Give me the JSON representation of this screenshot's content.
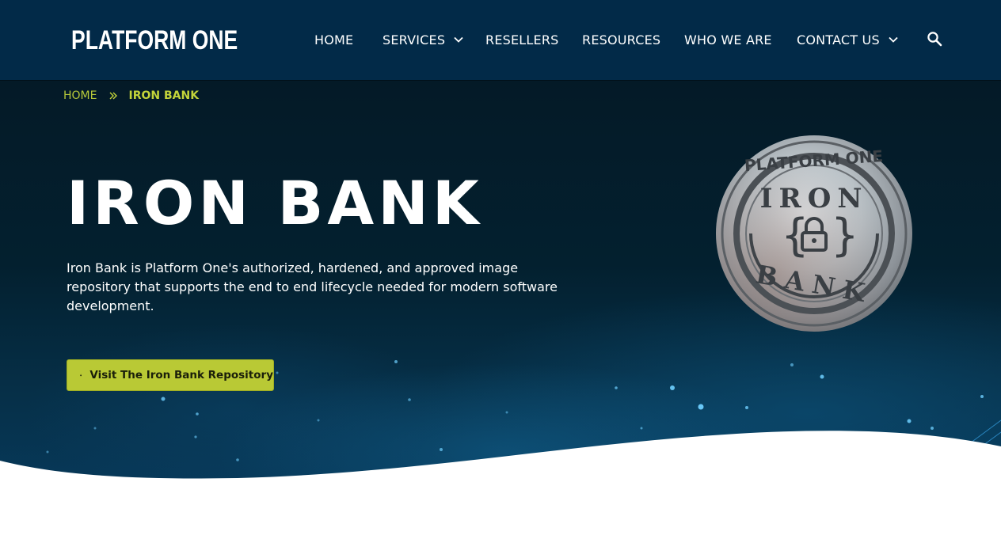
{
  "header": {
    "logo_text": "PLATFORM ONE",
    "nav": [
      {
        "label": "HOME",
        "has_dropdown": false
      },
      {
        "label": "SERVICES",
        "has_dropdown": true
      },
      {
        "label": "RESELLERS",
        "has_dropdown": false
      },
      {
        "label": "RESOURCES",
        "has_dropdown": false
      },
      {
        "label": "WHO WE ARE",
        "has_dropdown": false
      },
      {
        "label": "CONTACT US",
        "has_dropdown": true
      }
    ],
    "search_icon": "search-icon"
  },
  "breadcrumb": {
    "home": "HOME",
    "separator_icon": "double-chevron-right-icon",
    "current": "IRON BANK"
  },
  "hero": {
    "title": "IRON BANK",
    "description": "Iron Bank is Platform One's authorized, hardened, and approved image repository that supports the end to end lifecycle needed for modern software development.",
    "cta_label": "Visit The Iron Bank Repository",
    "cta_icon": "lock-icon"
  },
  "seal": {
    "top_text": "PLATFORM ONE",
    "middle_text": "IRON",
    "bottom_text": "BANK"
  },
  "colors": {
    "header_bg": "#022a48",
    "accent": "#b9c935",
    "hero_dark": "#041a27",
    "text_light": "#ffffff"
  }
}
